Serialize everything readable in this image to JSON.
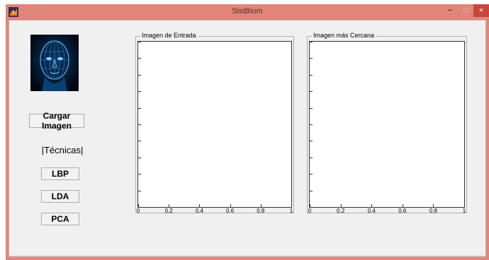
{
  "window": {
    "title": "SistBiom",
    "minimize_glyph": "−",
    "maximize_glyph": "□",
    "close_glyph": "×"
  },
  "sidebar": {
    "load_button": "Cargar Imagen",
    "techniques_label": "|Técnicas|",
    "lbp_button": "LBP",
    "lda_button": "LDA",
    "pca_button": "PCA"
  },
  "panels": {
    "input_title": "Imagen de Entrada",
    "nearest_title": "Imagen más Cercana"
  },
  "axes": {
    "input_xticks": [
      "0",
      "0.2",
      "0.4",
      "0.6",
      "0.8",
      "1"
    ],
    "nearest_xticks": [
      "0",
      "0.2",
      "0.4",
      "0.6",
      "0.8",
      "1"
    ]
  },
  "colors": {
    "title_bar": "#e1857a",
    "close_button": "#c9463a",
    "face_glow": "#3aa0ff"
  },
  "icons": {
    "app": "matlab-icon",
    "face": "wireframe-face-image"
  }
}
